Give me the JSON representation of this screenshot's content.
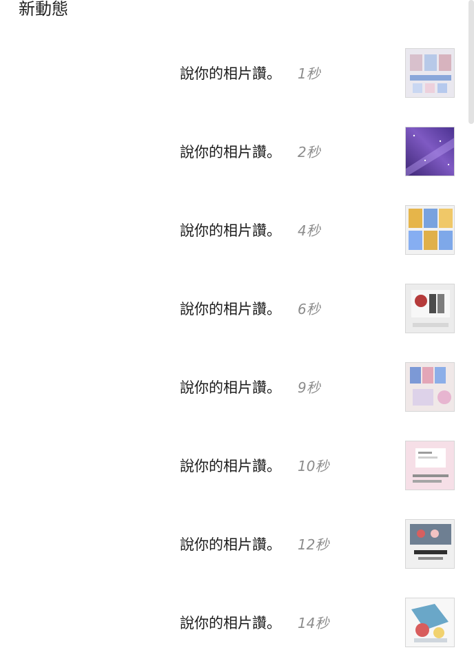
{
  "header": {
    "title": "新動態"
  },
  "notifications": [
    {
      "text": "說你的相片讚。",
      "time": "1秒",
      "thumb_colors": [
        "#e9e6ee",
        "#d6b6c6",
        "#7f9fd0"
      ]
    },
    {
      "text": "說你的相片讚。",
      "time": "2秒",
      "thumb_colors": [
        "#4b2f83",
        "#8a62c6",
        "#c8b0ff"
      ]
    },
    {
      "text": "說你的相片讚。",
      "time": "4秒",
      "thumb_colors": [
        "#f1f1f1",
        "#e7b84f",
        "#6f9ad9"
      ]
    },
    {
      "text": "說你的相片讚。",
      "time": "6秒",
      "thumb_colors": [
        "#eeeeee",
        "#b83a3a",
        "#555555"
      ]
    },
    {
      "text": "說你的相片讚。",
      "time": "9秒",
      "thumb_colors": [
        "#efe7e7",
        "#7f9bd3",
        "#e2a0b3"
      ]
    },
    {
      "text": "說你的相片讚。",
      "time": "10秒",
      "thumb_colors": [
        "#f6dfe7",
        "#ffffff",
        "#9a9a9a"
      ]
    },
    {
      "text": "說你的相片讚。",
      "time": "12秒",
      "thumb_colors": [
        "#f0f0f0",
        "#6e7f92",
        "#d65f5f"
      ]
    },
    {
      "text": "說你的相片讚。",
      "time": "14秒",
      "thumb_colors": [
        "#f7f7f7",
        "#6aa7c8",
        "#d85d5d"
      ]
    }
  ]
}
